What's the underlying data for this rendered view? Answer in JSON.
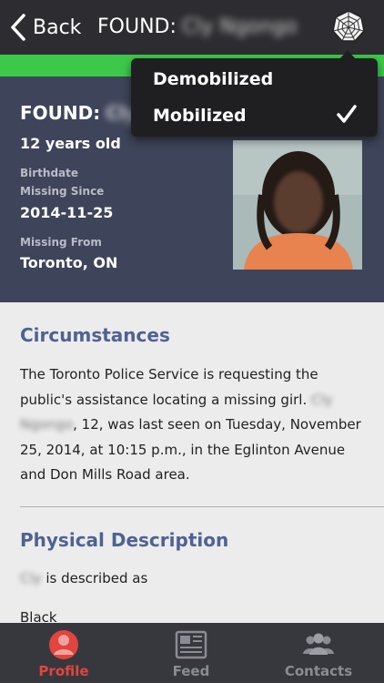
{
  "navbar": {
    "back_label": "Back",
    "title_prefix": "FOUND:",
    "title_name": "Cly Ngongo"
  },
  "status_menu": {
    "options": [
      "Demobilized",
      "Mobilized"
    ],
    "selected": "Mobilized"
  },
  "profile": {
    "found_prefix": "FOUND:",
    "name": "Cly Ngongo",
    "age": "12 years old",
    "birthdate_label": "Birthdate",
    "missing_since_label": "Missing Since",
    "missing_since": "2014-11-25",
    "missing_from_label": "Missing From",
    "missing_from": "Toronto, ON"
  },
  "circumstances": {
    "title": "Circumstances",
    "text_start": "The Toronto Police Service is requesting the public's assistance locating a missing girl.",
    "name": "Cly Ngongo",
    "text_end": ", 12, was last seen on Tuesday, November 25, 2014, at 10:15 p.m., in the Eglinton Avenue and Don Mills Road area."
  },
  "physical": {
    "title": "Physical Description",
    "name": "Cly",
    "described_as": "is described as",
    "race": "Black"
  },
  "tabs": [
    {
      "label": "Profile",
      "icon": "person-icon",
      "active": true
    },
    {
      "label": "Feed",
      "icon": "newspaper-icon",
      "active": false
    },
    {
      "label": "Contacts",
      "icon": "people-icon",
      "active": false
    }
  ],
  "colors": {
    "status_bar": "#3cc94a",
    "header_bg": "#3e4459",
    "section_title": "#4e6294",
    "active_tab": "#e2443e"
  }
}
